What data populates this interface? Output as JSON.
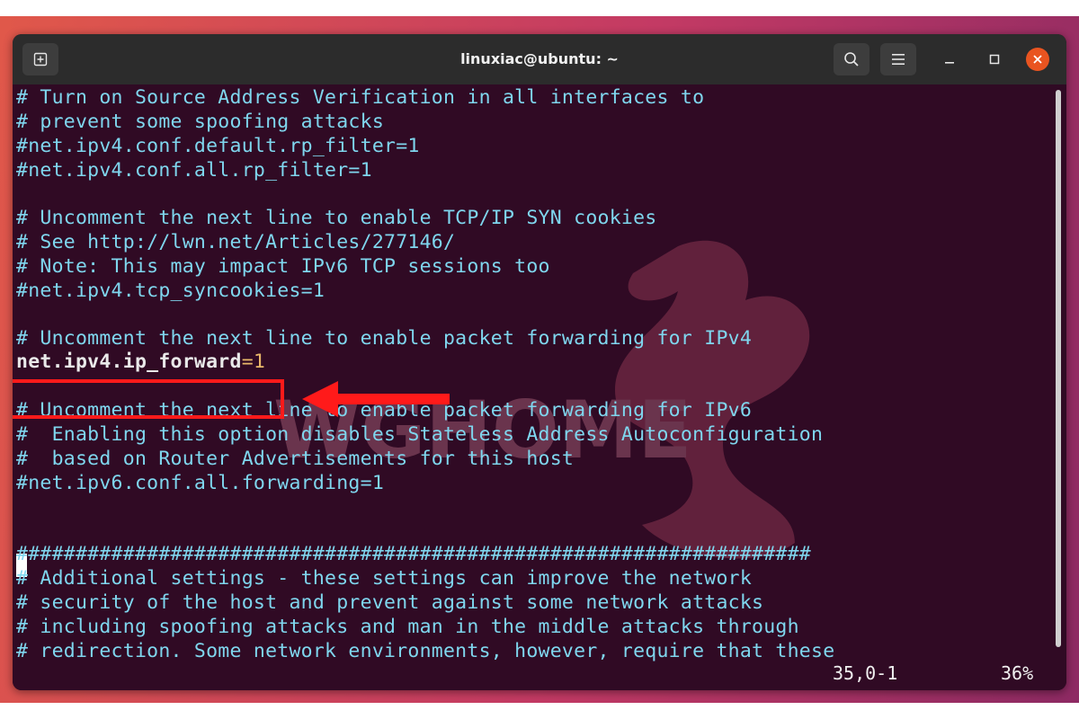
{
  "window": {
    "title": "linuxiac@ubuntu: ~"
  },
  "titlebar": {
    "new_tab_icon": "new-tab-icon",
    "search_icon": "search-icon",
    "menu_icon": "hamburger-menu-icon",
    "minimize_icon": "minimize-icon",
    "maximize_icon": "maximize-icon",
    "close_icon": "close-icon",
    "close_color": "#e95420"
  },
  "terminal": {
    "background": "#300a24",
    "comment_color": "#7fd6ee",
    "lines": {
      "l1": "# Turn on Source Address Verification in all interfaces to",
      "l2": "# prevent some spoofing attacks",
      "l3": "#net.ipv4.conf.default.rp_filter=1",
      "l4": "#net.ipv4.conf.all.rp_filter=1",
      "l5": "# Uncomment the next line to enable TCP/IP SYN cookies",
      "l6": "# See http://lwn.net/Articles/277146/",
      "l7": "# Note: This may impact IPv6 TCP sessions too",
      "l8": "#net.ipv4.tcp_syncookies=1",
      "l9": "# Uncomment the next line to enable packet forwarding for IPv4",
      "l10_key": "net.ipv4.ip_forward",
      "l10_eq": "=",
      "l10_val": "1",
      "l11": "# Uncomment the next line to enable packet forwarding for IPv6",
      "l12": "#  Enabling this option disables Stateless Address Autoconfiguration",
      "l13": "#  based on Router Advertisements for this host",
      "l14": "#net.ipv6.conf.all.forwarding=1",
      "l15": "###################################################################",
      "l16": "# Additional settings - these settings can improve the network",
      "l17": "# security of the host and prevent against some network attacks",
      "l18": "# including spoofing attacks and man in the middle attacks through",
      "l19": "# redirection. Some network environments, however, require that these"
    },
    "status": {
      "position": "35,0-1",
      "percent": "36%"
    }
  },
  "annotation": {
    "highlight_color": "#ff1a1a",
    "arrow_icon": "arrow-left-icon"
  },
  "watermark": {
    "text": "WGHOME",
    "logo_icon": "dragon-logo-icon"
  }
}
